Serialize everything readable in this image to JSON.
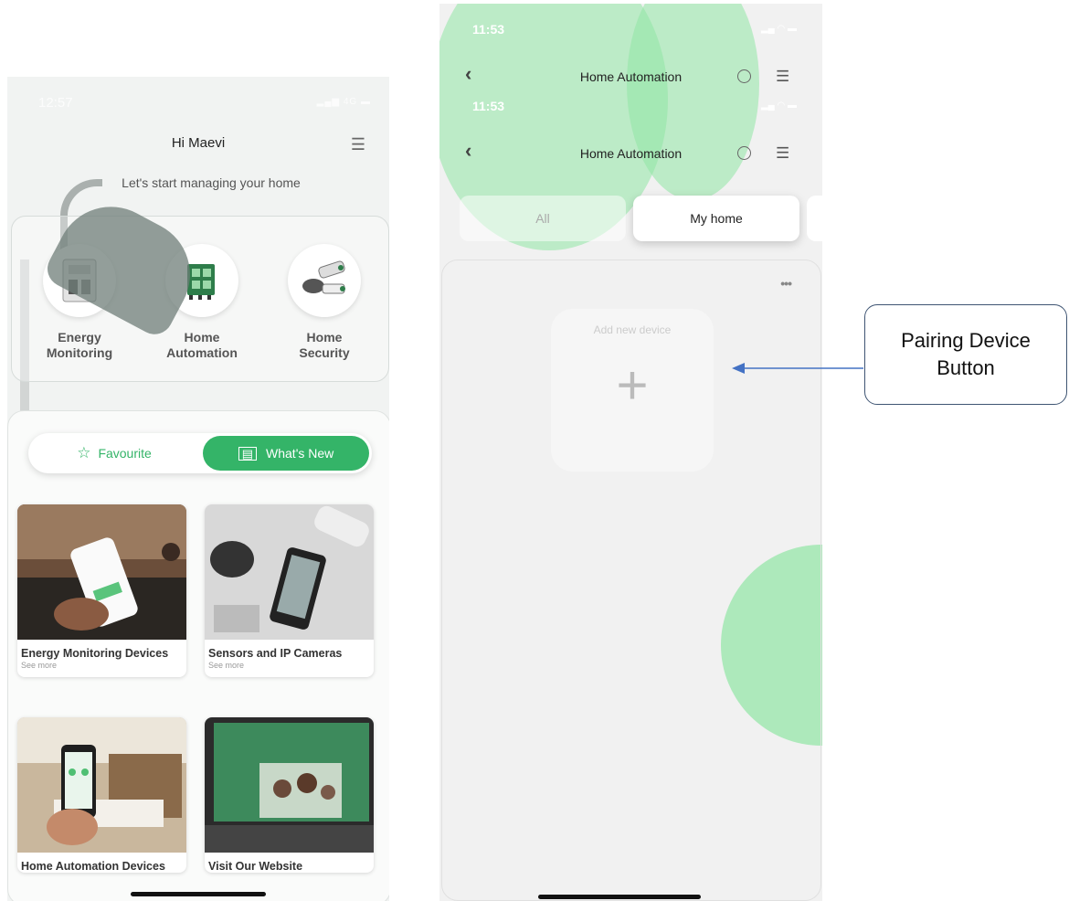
{
  "left_screen": {
    "status_time": "12:57",
    "status_signal": "4G",
    "greeting": "Hi Maevi",
    "subtitle": "Let's start managing your home",
    "categories": [
      {
        "label_line1": "Energy",
        "label_line2": "Monitoring",
        "icon": "energy-meter-icon"
      },
      {
        "label_line1": "Home",
        "label_line2": "Automation",
        "icon": "circuit-board-icon"
      },
      {
        "label_line1": "Home",
        "label_line2": "Security",
        "icon": "security-camera-icon"
      }
    ],
    "toggle": {
      "favourite_label": "Favourite",
      "whats_new_label": "What's New"
    },
    "cards": [
      {
        "title": "Energy Monitoring Devices",
        "see_more": "See more"
      },
      {
        "title": "Sensors and IP Cameras",
        "see_more": "See more"
      },
      {
        "title": "Home Automation Devices",
        "see_more": ""
      },
      {
        "title": "Visit Our Website",
        "see_more": ""
      }
    ]
  },
  "right_screen": {
    "status_time": "11:53",
    "header_title": "Home Automation",
    "tabs": [
      {
        "label": "All"
      },
      {
        "label": "My home"
      }
    ],
    "more_dots": "•••",
    "add_device_label": "Add new device",
    "add_device_symbol": "+"
  },
  "callout": {
    "line1": "Pairing Device",
    "line2": "Button"
  },
  "colors": {
    "accent_green": "#34b468",
    "blob_green": "#90e6a4",
    "callout_border": "#3f5573",
    "arrow": "#4472c4"
  }
}
